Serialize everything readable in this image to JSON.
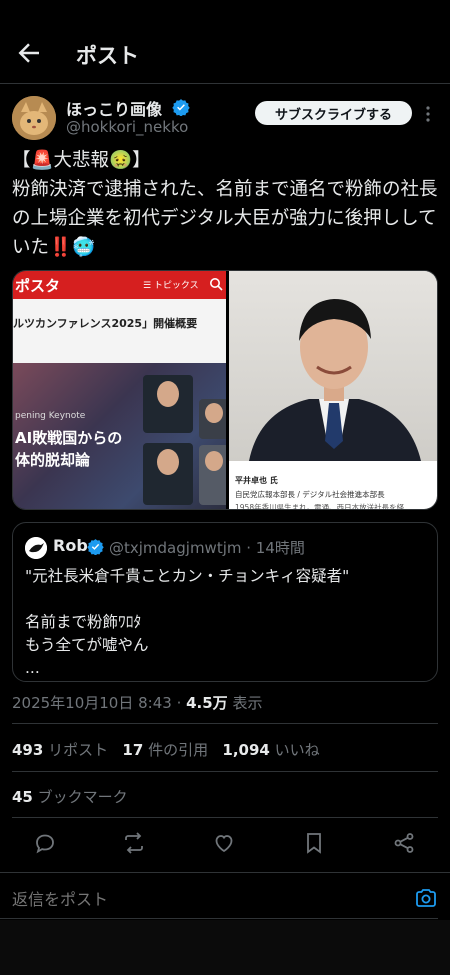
{
  "header": {
    "title": "ポスト"
  },
  "author": {
    "display_name": "ほっこり画像",
    "handle": "@hokkori_nekko",
    "subscribe_label": "サブスクライブする"
  },
  "tweet": {
    "text": "【🚨大悲報🤢】\n粉飾決済で逮捕された、名前まで通名で粉飾の社長の上場企業を初代デジタル大臣が強力に後押ししていた‼️🥶"
  },
  "media": {
    "left": {
      "site_logo": "ポスタ",
      "menu_label": "☰ トピックス",
      "conference_title": "ルツカンファレンス2025」開催概要",
      "keynote_label": "pening Keynote",
      "keynote_title": "AI敗戦国からの\n体的脱却論"
    },
    "right": {
      "name": "平井卓也 氏",
      "role": "自民党広報本部長 / デジタル社会推進本部長",
      "bio": "1958年香川県生まれ。電通、西日本放送社長を経"
    }
  },
  "quote": {
    "name": "Rob",
    "handle_time": "@txjmdagjmwtjm · 14時間",
    "text": "\"元社長米倉千貴ことカン・チョンキィ容疑者\"\n\n名前まで粉飾ﾜﾛﾀ\nもう全てが嘘やん\n..."
  },
  "meta": {
    "timestamp": "2025年10月10日 8:43 · ",
    "views": "4.5万",
    "views_label": " 表示"
  },
  "stats": {
    "reposts": "493",
    "reposts_label": "リポスト",
    "quotes": "17",
    "quotes_label": "件の引用",
    "likes": "1,094",
    "likes_label": "いいね",
    "bookmarks": "45",
    "bookmarks_label": "ブックマーク"
  },
  "reply": {
    "placeholder": "返信をポスト"
  },
  "colors": {
    "accent": "#1d9bf0",
    "background": "#000000",
    "text": "#e7e9ea",
    "muted": "#71767b"
  }
}
